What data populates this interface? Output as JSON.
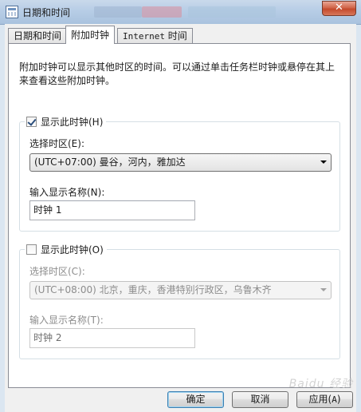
{
  "window": {
    "title": "日期和时间",
    "close_glyph": "✕"
  },
  "tabs": [
    {
      "label": "日期和时间"
    },
    {
      "label": "附加时钟"
    },
    {
      "label_prefix": "Internet",
      "label_suffix": " 时间"
    }
  ],
  "description": "附加时钟可以显示其他时区的时间。可以通过单击任务栏时钟或悬停在其上来查看这些附加时钟。",
  "clock1": {
    "show_label": "显示此时钟(H)",
    "checked": true,
    "timezone_label": "选择时区(E):",
    "timezone_value": "(UTC+07:00) 曼谷，河内，雅加达",
    "name_label": "输入显示名称(N):",
    "name_value": "时钟 1"
  },
  "clock2": {
    "show_label": "显示此时钟(O)",
    "checked": false,
    "timezone_label": "选择时区(C):",
    "timezone_value": "(UTC+08:00) 北京，重庆，香港特别行政区，乌鲁木齐",
    "name_label": "输入显示名称(T):",
    "name_value": "时钟 2"
  },
  "buttons": {
    "ok": "确定",
    "cancel": "取消",
    "apply_prefix": "应用(",
    "apply_key": "A",
    "apply_suffix": ")"
  },
  "watermark": "Baidu 经验",
  "icons": [
    "window-app-icon",
    "close-icon",
    "checkbox-checked-icon",
    "checkbox-unchecked-icon",
    "dropdown-arrow-icon"
  ]
}
